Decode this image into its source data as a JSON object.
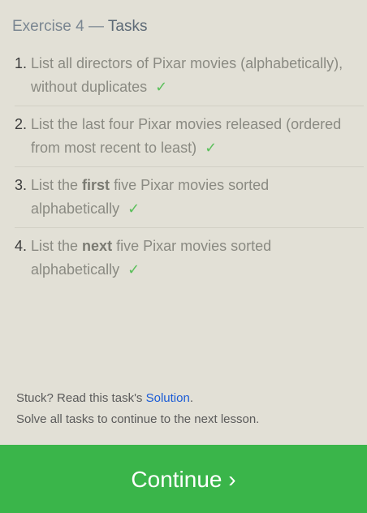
{
  "header": {
    "exercise_label": "Exercise 4",
    "separator": " — ",
    "title": "Tasks"
  },
  "tasks": [
    {
      "number": "1.",
      "pre": "List all directors of Pixar movies (alphabetically), without duplicates",
      "bold": "",
      "post": "",
      "status_icon": "check-icon",
      "status": "✓"
    },
    {
      "number": "2.",
      "pre": "List the last four Pixar movies released (ordered from most recent to least)",
      "bold": "",
      "post": "",
      "status_icon": "check-icon",
      "status": "✓"
    },
    {
      "number": "3.",
      "pre": "List the ",
      "bold": "first",
      "post": " five Pixar movies sorted alphabetically",
      "status_icon": "check-icon",
      "status": "✓"
    },
    {
      "number": "4.",
      "pre": "List the ",
      "bold": "next",
      "post": " five Pixar movies sorted alphabetically",
      "status_icon": "check-icon",
      "status": "✓"
    }
  ],
  "footer": {
    "stuck_text": "Stuck? Read this task's ",
    "solution_link": "Solution",
    "period": ".",
    "instruction": "Solve all tasks to continue to the next lesson."
  },
  "continue_button": {
    "label": "Continue ›"
  },
  "colors": {
    "background": "#e2e0d6",
    "accent_green": "#3ab54a",
    "check_green": "#5bbf5b",
    "link_blue": "#1a5bd6"
  }
}
